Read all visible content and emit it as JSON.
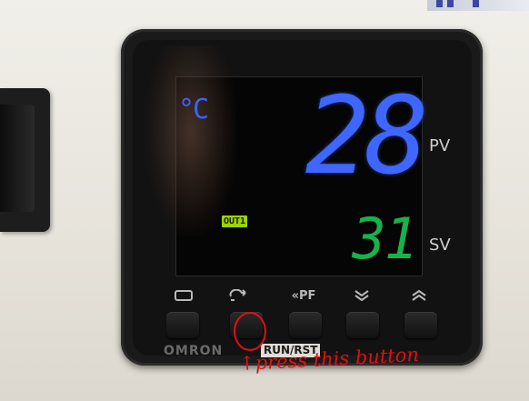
{
  "display": {
    "unit": "°C",
    "pv_value": "28",
    "sv_value": "31",
    "out_indicator": "OUT1",
    "pv_label": "PV",
    "sv_label": "SV"
  },
  "keys": {
    "mode_icon": "rectangle-icon",
    "cycle_icon": "cycle-arrows-icon",
    "pf_label": "«PF",
    "down_icon": "double-chevron-down-icon",
    "up_icon": "double-chevron-up-icon"
  },
  "panel": {
    "brand": "OMRON",
    "run_rst": "RUN/RST"
  },
  "annotation": {
    "note": "↑press this button"
  },
  "colors": {
    "pv_blue": "#3f67ff",
    "sv_green": "#17b34a",
    "out_badge": "#9bd400",
    "annotation_red": "#e01010"
  }
}
